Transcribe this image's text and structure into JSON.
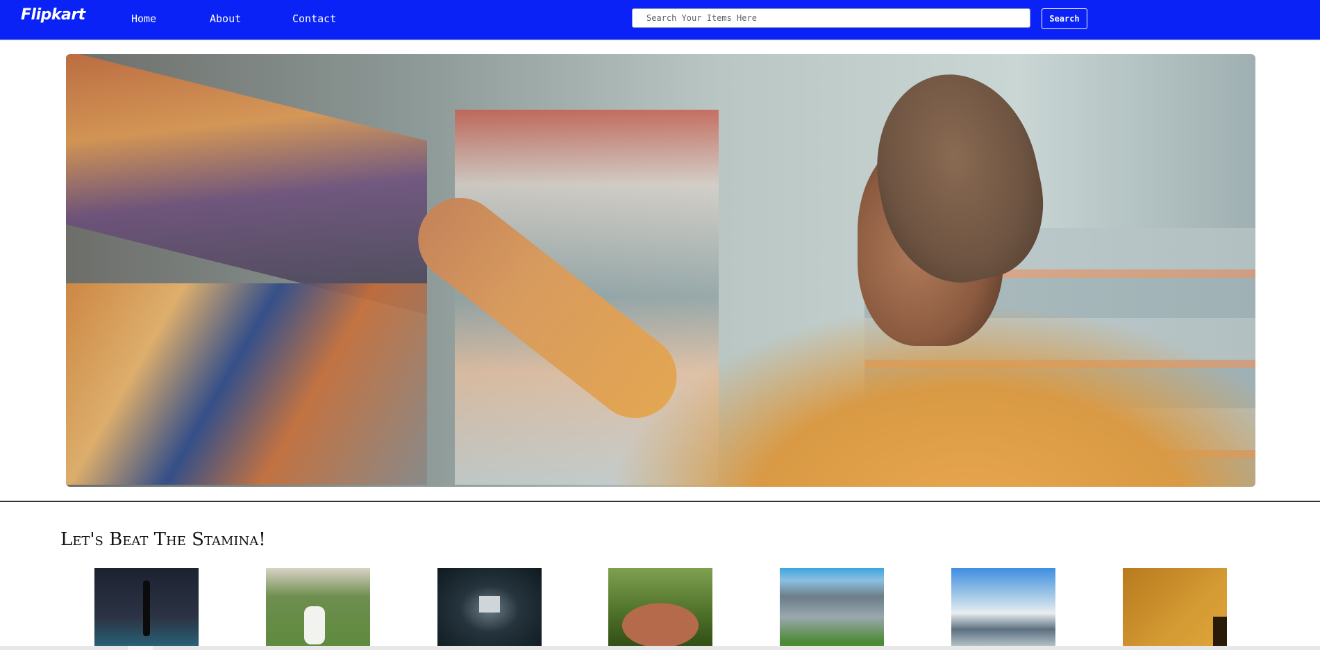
{
  "header": {
    "brand": "Flipkart",
    "nav": [
      {
        "label": "Home"
      },
      {
        "label": "About"
      },
      {
        "label": "Contact"
      }
    ],
    "search": {
      "placeholder": "Search Your Items Here",
      "value": "",
      "button_label": "Search"
    },
    "colors": {
      "navbar": "#0a22f5",
      "text": "#ffffff"
    }
  },
  "hero": {
    "image": "man-shopping-grocery-shelf-photo"
  },
  "section": {
    "title": "Let's Beat The Stamina!",
    "thumbnails": [
      {
        "image": "badminton-player-photo"
      },
      {
        "image": "cricket-batsman-photo"
      },
      {
        "image": "stadium-tunnel-photo"
      },
      {
        "image": "rugby-ball-on-grass-photo"
      },
      {
        "image": "baseball-stadium-photo"
      },
      {
        "image": "snowy-mountains-lake-photo"
      },
      {
        "image": "basketball-hoop-orange-photo"
      }
    ]
  },
  "taskbar": {
    "clock": ""
  }
}
